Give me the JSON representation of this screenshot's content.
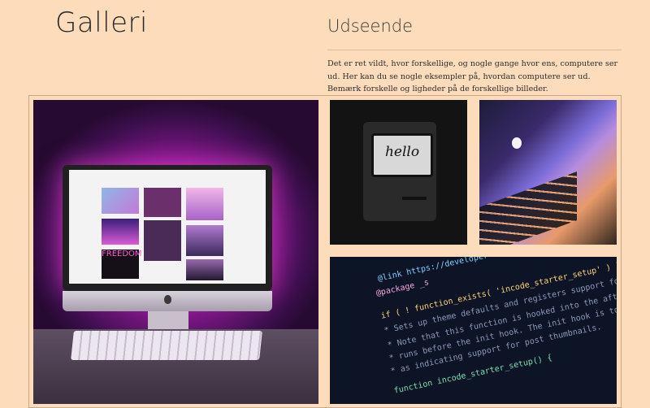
{
  "page": {
    "title": "Galleri",
    "section_title": "Udseende",
    "description": "Det er ret vildt, hvor forskellige, og nogle gange hvor ens, computere ser ud. Her kan du se nogle eksempler på, hvordan computere ser ud. Bemærk forskelle og ligheder på de forskellige billeder."
  },
  "images": {
    "mac_screen_text": "hello",
    "code_lines": [
      "@link https://developer",
      "@package _s",
      "if ( ! function_exists( 'incode_starter_setup' ) ) :",
      "* Sets up theme defaults and registers support for various WordPress",
      "* Note that this function is hooked into the after_setup_theme hook,",
      "* runs before the init hook. The init hook is too late for some features",
      "* as indicating support for post thumbnails.",
      "function incode_starter_setup() {"
    ],
    "imac_wall_text": "FREEDOM"
  }
}
